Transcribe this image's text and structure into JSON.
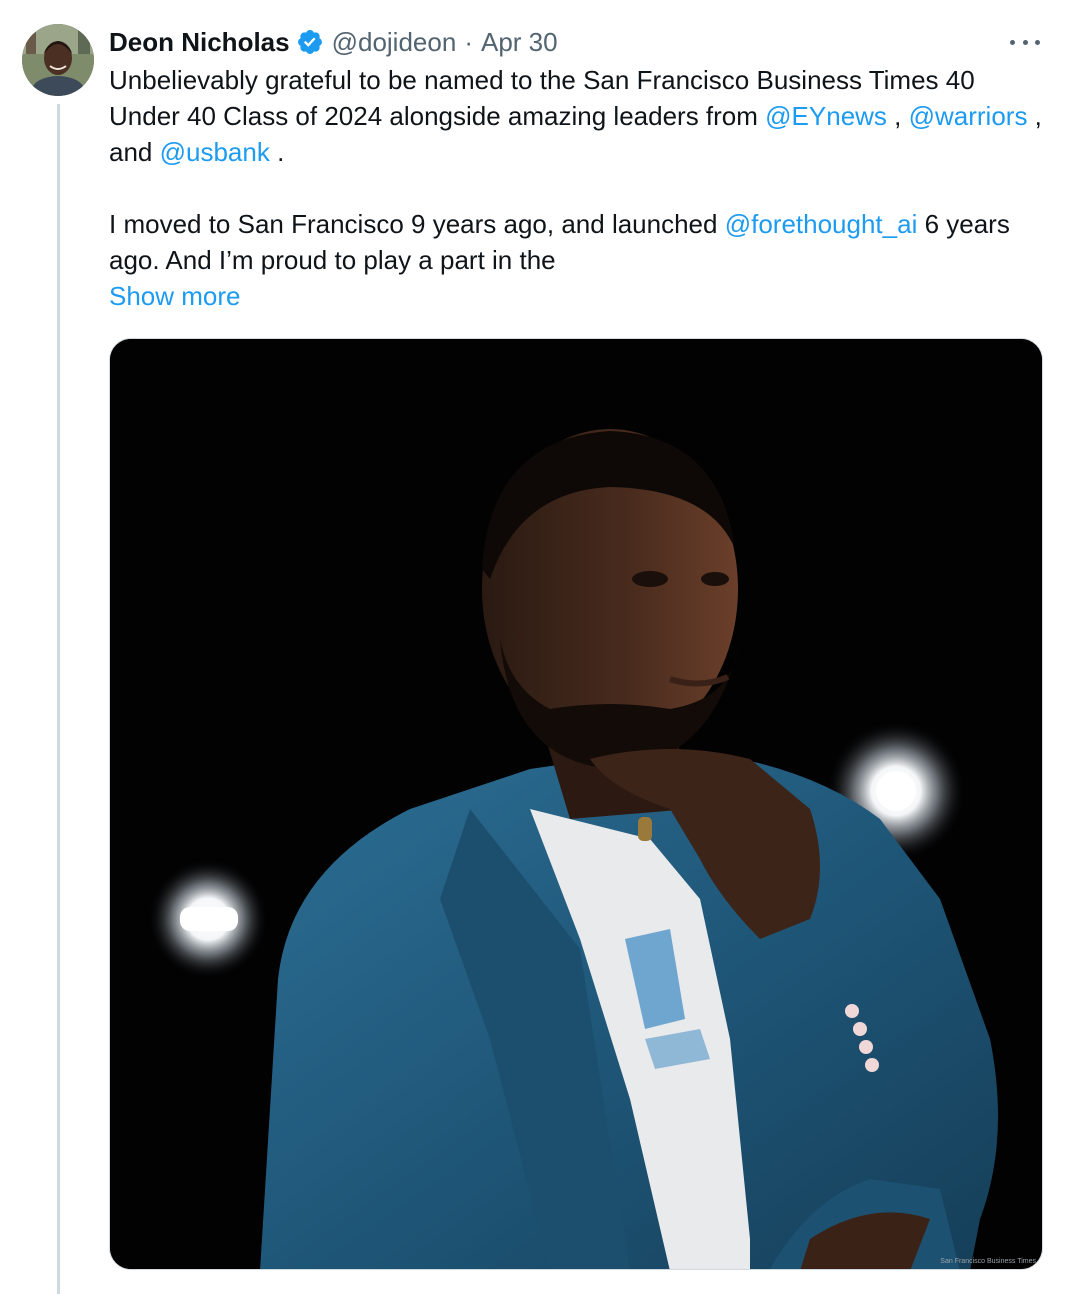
{
  "tweet": {
    "author_name": "Deon Nicholas",
    "handle": "@dojideon",
    "separator": "·",
    "date": "Apr 30",
    "verified_icon": "verified-badge-icon",
    "more_icon": "more-horizontal-icon",
    "lines": {
      "p1_a": "Unbelievably grateful to be named to the San Francisco Business Times 40 Under 40 Class of 2024 alongside amazing leaders from ",
      "mention_1": "@EYnews",
      "p1_b": " , ",
      "mention_2": "@warriors",
      "p1_c": " , and ",
      "mention_3": "@usbank",
      "p1_d": " .",
      "p2_a": "I moved to San Francisco 9 years ago, and launched ",
      "mention_4": "@forethought_ai",
      "p2_b": " 6 years ago. And I’m proud to play a part in the"
    },
    "show_more": "Show more",
    "photo_credit": "San Francisco Business Times"
  },
  "colors": {
    "text": "#0f1419",
    "secondary": "#536471",
    "link": "#1d9bf0",
    "verified": "#1d9bf0",
    "thread_line": "#cfd9de"
  }
}
